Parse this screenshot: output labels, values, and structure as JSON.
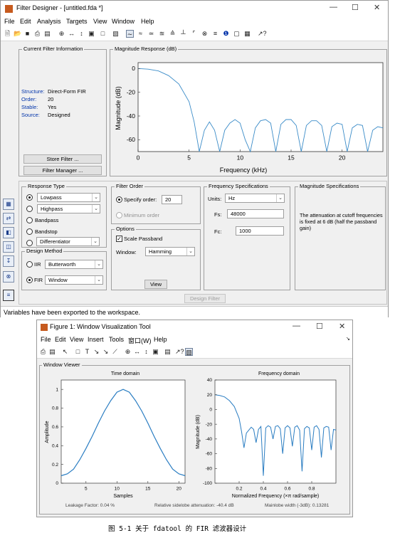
{
  "fd": {
    "title": "Filter Designer - [untitled.fda *]",
    "menu": [
      "File",
      "Edit",
      "Analysis",
      "Targets",
      "View",
      "Window",
      "Help"
    ],
    "current_filter": {
      "heading": "Current Filter Information",
      "rows": [
        {
          "label": "Structure:",
          "value": "Direct-Form FIR"
        },
        {
          "label": "Order:",
          "value": "20"
        },
        {
          "label": "Stable:",
          "value": "Yes"
        },
        {
          "label": "Source:",
          "value": "Designed"
        }
      ],
      "store_button": "Store Filter ...",
      "manager_button": "Filter Manager ..."
    },
    "mag_response": {
      "heading": "Magnitude Response (dB)",
      "ylabel": "Magnitude (dB)",
      "xlabel": "Frequency (kHz)",
      "yticks": [
        "0",
        "-20",
        "-40",
        "-60"
      ],
      "xticks": [
        "0",
        "5",
        "10",
        "15",
        "20"
      ]
    },
    "response_type": {
      "heading": "Response Type",
      "options": [
        {
          "label": "Lowpass",
          "combo": "Lowpass",
          "checked": true
        },
        {
          "label": "Highpass",
          "combo": "Highpass",
          "checked": false
        },
        {
          "label": "Bandpass",
          "combo": "",
          "checked": false
        },
        {
          "label": "Bandstop",
          "combo": "",
          "checked": false
        },
        {
          "label": "",
          "combo": "Differentiator",
          "checked": false
        }
      ]
    },
    "design_method": {
      "heading": "Design Method",
      "iir_label": "IIR",
      "iir_value": "Butterworth",
      "fir_label": "FIR",
      "fir_value": "Window"
    },
    "filter_order": {
      "heading": "Filter Order",
      "specify_label": "Specify order:",
      "specify_value": "20",
      "minimum_label": "Minimum order"
    },
    "options": {
      "heading": "Options",
      "scale_label": "Scale Passband",
      "window_label": "Window:",
      "window_value": "Hamming",
      "view_button": "View"
    },
    "freq_spec": {
      "heading": "Frequency Specifications",
      "units_label": "Units:",
      "units_value": "Hz",
      "fs_label": "Fs:",
      "fs_value": "48000",
      "fc_label": "Fc:",
      "fc_value": "1000"
    },
    "mag_spec": {
      "heading": "Magnitude Specifications",
      "text": "The attenuation at cutoff frequencies is fixed at 6 dB (half the passband gain)"
    },
    "design_button": "Design Filter",
    "status": "Variables have been exported to the workspace."
  },
  "wv": {
    "title": "Figure 1: Window Visualization Tool",
    "menu": [
      "File",
      "Edit",
      "View",
      "Insert",
      "Tools",
      "窗口(W)",
      "Help"
    ],
    "heading": "Window Viewer",
    "time": {
      "title": "Time domain",
      "xlabel": "Samples",
      "ylabel": "Amplitude",
      "yticks": [
        "1",
        "0.8",
        "0.6",
        "0.4",
        "0.2",
        "0"
      ],
      "xticks": [
        "5",
        "10",
        "15",
        "20"
      ]
    },
    "freq": {
      "title": "Frequency domain",
      "xlabel": "Normalized Frequency  (×π rad/sample)",
      "ylabel": "Magnitude (dB)",
      "yticks": [
        "40",
        "20",
        "0",
        "-20",
        "-40",
        "-60",
        "-80",
        "-100"
      ],
      "xticks": [
        "0.2",
        "0.4",
        "0.6",
        "0.8"
      ]
    },
    "leakage": "Leakage Factor: 0.04 %",
    "sidelobe": "Relative sidelobe attenuation: -40.4 dB",
    "mainlobe": "Mainlobe width (-3dB): 0.13281"
  },
  "caption": "图 5-1 关于 fdatool 的 FIR 滤波器设计",
  "chart_data": [
    {
      "type": "line",
      "title": "Magnitude Response (dB)",
      "xlabel": "Frequency (kHz)",
      "ylabel": "Magnitude (dB)",
      "xlim": [
        0,
        24
      ],
      "ylim": [
        -70,
        5
      ],
      "x": [
        0,
        1,
        2,
        3,
        4,
        5,
        5.5,
        6,
        6.5,
        7,
        7.5,
        8,
        8.5,
        9,
        9.5,
        10,
        10.5,
        11,
        11.5,
        12,
        12.5,
        13,
        13.5,
        14,
        14.5,
        15,
        15.5,
        16,
        16.5,
        17,
        17.5,
        18,
        18.5,
        19,
        19.5,
        20,
        20.5,
        21,
        21.5,
        22,
        22.5,
        23,
        23.5,
        24
      ],
      "series": [
        {
          "values": [
            0,
            -0.5,
            -2,
            -6,
            -13,
            -28,
            -45,
            -70,
            -52,
            -45,
            -52,
            -70,
            -52,
            -46,
            -43,
            -46,
            -60,
            -70,
            -50,
            -44,
            -43,
            -46,
            -70,
            -47,
            -43,
            -43,
            -48,
            -70,
            -48,
            -44,
            -44,
            -48,
            -70,
            -49,
            -46,
            -47,
            -70,
            -50,
            -47,
            -48,
            -70,
            -52,
            -49,
            -50
          ]
        }
      ]
    },
    {
      "type": "line",
      "title": "Time domain",
      "xlabel": "Samples",
      "ylabel": "Amplitude",
      "xlim": [
        1,
        21
      ],
      "ylim": [
        0,
        1.1
      ],
      "x": [
        1,
        2,
        3,
        4,
        5,
        6,
        7,
        8,
        9,
        10,
        11,
        12,
        13,
        14,
        15,
        16,
        17,
        18,
        19,
        20,
        21
      ],
      "series": [
        {
          "values": [
            0.08,
            0.1,
            0.15,
            0.25,
            0.37,
            0.5,
            0.64,
            0.77,
            0.88,
            0.97,
            1,
            0.97,
            0.88,
            0.77,
            0.64,
            0.5,
            0.37,
            0.25,
            0.15,
            0.1,
            0.08
          ]
        }
      ]
    },
    {
      "type": "line",
      "title": "Frequency domain",
      "xlabel": "Normalized Frequency (×π rad/sample)",
      "ylabel": "Magnitude (dB)",
      "xlim": [
        0,
        1
      ],
      "ylim": [
        -100,
        40
      ],
      "x": [
        0,
        0.04,
        0.08,
        0.12,
        0.16,
        0.2,
        0.22,
        0.24,
        0.26,
        0.28,
        0.3,
        0.32,
        0.34,
        0.36,
        0.38,
        0.4,
        0.42,
        0.44,
        0.46,
        0.48,
        0.5,
        0.52,
        0.54,
        0.56,
        0.58,
        0.6,
        0.62,
        0.64,
        0.66,
        0.68,
        0.7,
        0.72,
        0.74,
        0.76,
        0.78,
        0.8,
        0.82,
        0.84,
        0.86,
        0.88,
        0.9,
        0.92,
        0.94,
        0.96,
        0.98,
        1.0
      ],
      "series": [
        {
          "values": [
            20,
            19,
            17,
            12,
            4,
            -12,
            -30,
            -52,
            -32,
            -28,
            -24,
            -27,
            -45,
            -27,
            -23,
            -90,
            -25,
            -22,
            -24,
            -40,
            -23,
            -22,
            -26,
            -60,
            -25,
            -22,
            -25,
            -50,
            -24,
            -22,
            -28,
            -84,
            -26,
            -23,
            -25,
            -55,
            -24,
            -22,
            -27,
            -65,
            -25,
            -23,
            -24,
            -55,
            -27,
            -28
          ]
        }
      ]
    }
  ]
}
